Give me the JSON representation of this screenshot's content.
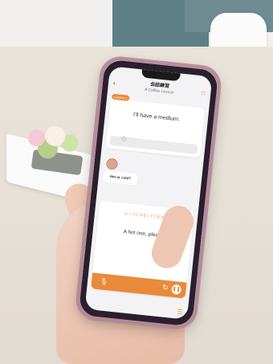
{
  "app": {
    "header_title": "会話練習",
    "header_subtitle": "A Coffee Lesson",
    "badge": "Lesson 1",
    "prompt_line": "I'll have a medium.",
    "speaker_question": "Hot or cold?",
    "hint": "ヒントにするしてください",
    "answer": "A hot one, please."
  },
  "icons": {
    "back": "chevron-left-icon",
    "star": "star-icon",
    "mic": "mic-icon",
    "refresh": "refresh-icon",
    "play": "play-icon",
    "menu": "menu-icon"
  },
  "colors": {
    "accent": "#e98a3a",
    "case": "#b18796"
  }
}
